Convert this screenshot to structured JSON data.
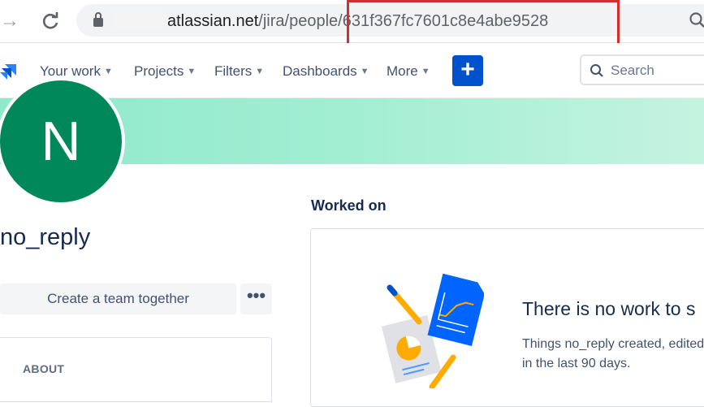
{
  "browser": {
    "url_host": "atlassian.net",
    "url_path": "/jira/people/631f367fc7601c8e4abe9528"
  },
  "nav": {
    "items": [
      {
        "label": "Your work"
      },
      {
        "label": "Projects"
      },
      {
        "label": "Filters"
      },
      {
        "label": "Dashboards"
      },
      {
        "label": "More"
      }
    ],
    "create_label": "+",
    "search_placeholder": "Search"
  },
  "profile": {
    "initial": "N",
    "name": "no_reply",
    "team_button": "Create a team together",
    "more_button": "•••",
    "about_title": "ABOUT"
  },
  "worked_on": {
    "title": "Worked on",
    "empty_title": "There is no work to s",
    "empty_desc_line1": "Things no_reply created, edited",
    "empty_desc_line2": "in the last 90 days."
  },
  "colors": {
    "brand": "#0052cc",
    "avatar": "#00875a",
    "highlight": "#d32f2f"
  }
}
